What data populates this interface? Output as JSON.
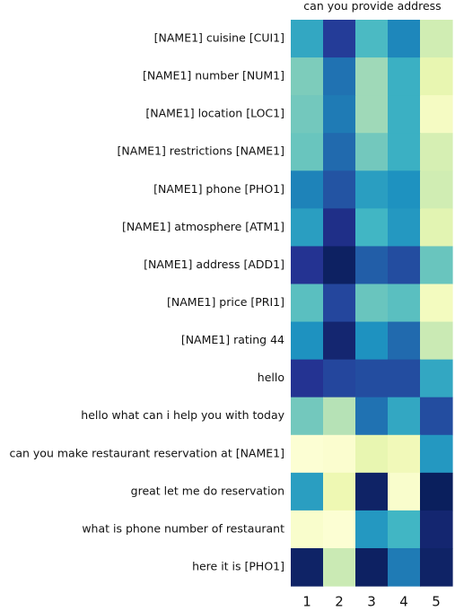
{
  "chart_data": {
    "type": "heatmap",
    "title": "can you provide address",
    "xlabel": "",
    "ylabel": "",
    "columns": [
      "1",
      "2",
      "3",
      "4",
      "5"
    ],
    "rows": [
      "[NAME1] cuisine [CUI1]",
      "[NAME1] number [NUM1]",
      "[NAME1] location [LOC1]",
      "[NAME1] restrictions [NAME1]",
      "[NAME1] phone [PHO1]",
      "[NAME1] atmosphere [ATM1]",
      "[NAME1] address [ADD1]",
      "[NAME1] price [PRI1]",
      "[NAME1] rating 44",
      "hello",
      "hello what can i help you with today",
      "can you make restaurant reservation at [NAME1]",
      "great let me do reservation",
      "what is phone number of restaurant",
      "here it is [PHO1]"
    ],
    "values": [
      [
        0.55,
        0.85,
        0.48,
        0.65,
        0.22
      ],
      [
        0.38,
        0.7,
        0.32,
        0.52,
        0.14
      ],
      [
        0.4,
        0.68,
        0.32,
        0.52,
        0.07
      ],
      [
        0.42,
        0.72,
        0.4,
        0.52,
        0.2
      ],
      [
        0.66,
        0.78,
        0.58,
        0.62,
        0.22
      ],
      [
        0.58,
        0.9,
        0.5,
        0.6,
        0.16
      ],
      [
        0.88,
        0.98,
        0.75,
        0.8,
        0.42
      ],
      [
        0.45,
        0.82,
        0.42,
        0.45,
        0.08
      ],
      [
        0.62,
        0.95,
        0.62,
        0.72,
        0.24
      ],
      [
        0.88,
        0.82,
        0.8,
        0.8,
        0.55
      ],
      [
        0.4,
        0.28,
        0.7,
        0.55,
        0.8
      ],
      [
        0.02,
        0.03,
        0.14,
        0.1,
        0.6
      ],
      [
        0.58,
        0.12,
        0.97,
        0.04,
        0.99
      ],
      [
        0.04,
        0.02,
        0.6,
        0.5,
        0.95
      ],
      [
        0.97,
        0.24,
        0.98,
        0.68,
        0.97
      ]
    ],
    "colormap": [
      "#ffffd9",
      "#edf8b1",
      "#c7e9b4",
      "#7fcdbb",
      "#41b6c4",
      "#1d91c0",
      "#225ea8",
      "#253494",
      "#081d58"
    ],
    "grid": false,
    "legend": "none"
  }
}
